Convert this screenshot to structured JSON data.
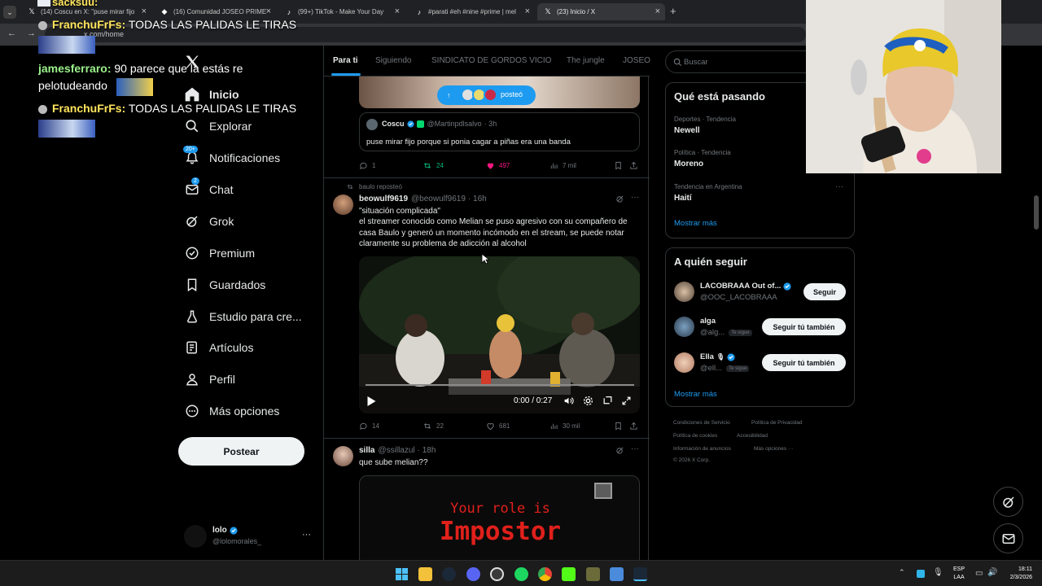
{
  "browser": {
    "tabs": [
      {
        "label": "(14) Coscu en X: \"puse mirar fijo",
        "favicon": "x-logo"
      },
      {
        "label": "(16) Comunidad JOSEO PRIME",
        "favicon": "community"
      },
      {
        "label": "(99+) TikTok - Make Your Day",
        "favicon": "tiktok"
      },
      {
        "label": "#parati #eh #nine #prime | mel",
        "favicon": "tiktok"
      },
      {
        "label": "(23) Inicio / X",
        "favicon": "x-logo"
      }
    ],
    "new_tab": "+",
    "url": "x.com/home"
  },
  "chat_overlay": [
    {
      "user": "sacksuu:",
      "text": "",
      "color": "#ffe55c"
    },
    {
      "user": "FranchuFrFs:",
      "text": "TODAS LAS PALIDAS LE TIRAS",
      "color": "#ffe55c"
    },
    {
      "user": "jamesferraro:",
      "text": "90 parece que la estás re pelotudeando",
      "color": "#9cf28c"
    },
    {
      "user": "FranchuFrFs:",
      "text": "TODAS LAS PALIDAS LE TIRAS",
      "color": "#ffe55c"
    }
  ],
  "sidebar": {
    "items": [
      {
        "label": "Inicio",
        "icon": "home-icon"
      },
      {
        "label": "Explorar",
        "icon": "search-icon"
      },
      {
        "label": "Notificaciones",
        "icon": "bell-icon",
        "badge": "20+"
      },
      {
        "label": "Chat",
        "icon": "mail-icon",
        "badge": "2"
      },
      {
        "label": "Grok",
        "icon": "grok-icon"
      },
      {
        "label": "Premium",
        "icon": "verified-icon"
      },
      {
        "label": "Guardados",
        "icon": "bookmark-icon"
      },
      {
        "label": "Estudio para cre...",
        "icon": "studio-icon"
      },
      {
        "label": "Artículos",
        "icon": "article-icon"
      },
      {
        "label": "Perfil",
        "icon": "person-icon"
      },
      {
        "label": "Más opciones",
        "icon": "more-circle-icon"
      }
    ],
    "post_button": "Postear",
    "account": {
      "name": "lolo",
      "handle": "@lolomorales_",
      "more": "···"
    }
  },
  "main": {
    "tabs": [
      "Para ti",
      "Siguiendo",
      "SINDICATO DE GORDOS VICIO",
      "The jungle",
      "JOSEO"
    ],
    "posted_pill": "posteó",
    "quote": {
      "name": "Coscu",
      "handle": "@Martinpdlsalvo",
      "time": "· 3h",
      "text": "puse mirar fijo porque si ponia cagar a piñas era una banda"
    },
    "tweet1_actions": {
      "replies": "1",
      "retweets": "24",
      "likes": "497",
      "views": "7 mil"
    },
    "tweet2": {
      "repost_label": "baulo reposteó",
      "name": "beowulf9619",
      "handle": "@beowulf9619",
      "time": "· 16h",
      "text1": "\"situación complicada\"",
      "text2": "el streamer conocido como Melian se puso agresivo con su compañero de casa Baulo y generó un momento incómodo en el stream, se puede notar claramente su problema de adicción al alcohol",
      "video_time": "0:00 / 0:27",
      "video_progress": 0,
      "actions": {
        "replies": "14",
        "retweets": "22",
        "likes": "681",
        "views": "30 mil"
      }
    },
    "tweet3": {
      "name": "silla",
      "handle": "@ssillazul",
      "time": "· 18h",
      "text": "que sube melian??",
      "image_line1": "Your role is",
      "image_line2": "Impostor"
    }
  },
  "right": {
    "search_placeholder": "Buscar",
    "trends_title": "Qué está pasando",
    "trends": [
      {
        "category": "Deportes · Tendencia",
        "name": "Newell"
      },
      {
        "category": "Política · Tendencia",
        "name": "Moreno"
      },
      {
        "category": "Tendencia en Argentina",
        "name": "Haití"
      }
    ],
    "show_more": "Mostrar más",
    "follow_title": "A quién seguir",
    "follow": [
      {
        "name": "LACOBRAAA Out of...",
        "handle": "@OOC_LACOBRAAA",
        "button": "Seguir",
        "follows_you": ""
      },
      {
        "name": "alga",
        "handle": "@alg...",
        "button": "Seguir tú también",
        "follows_you": "Te sigue"
      },
      {
        "name": "Ella",
        "handle": "@ell...",
        "button": "Seguir tú también",
        "follows_you": "Te sigue"
      }
    ],
    "show_more2": "Mostrar más",
    "footer": [
      "Condiciones de Servicio",
      "Política de Privacidad",
      "Política de cookies",
      "Accesibilidad",
      "Información de anuncios",
      "Más opciones ···",
      "© 2026 X Corp."
    ]
  },
  "taskbar": {
    "lang1": "ESP",
    "lang2": "LAA",
    "time": "18:11",
    "date": "2/3/2026"
  },
  "colors": {
    "accent": "#1d9bf0",
    "like": "#f91880",
    "retweet": "#00ba7c",
    "impostor": "#e0201b"
  }
}
